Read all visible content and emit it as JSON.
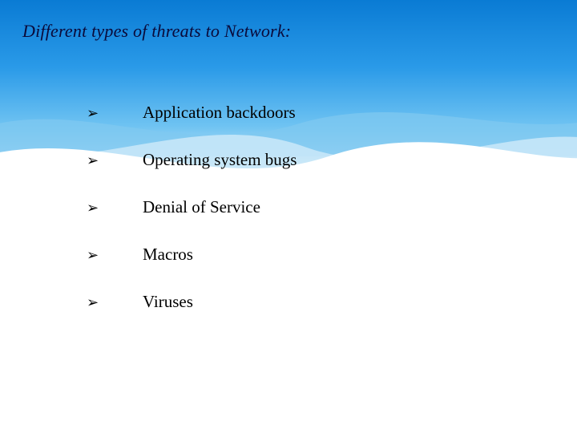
{
  "title": "Different types of threats to Network:",
  "bullet": "➢",
  "items": [
    "Application backdoors",
    "Operating system bugs",
    "Denial of Service",
    "Macros",
    "Viruses"
  ]
}
